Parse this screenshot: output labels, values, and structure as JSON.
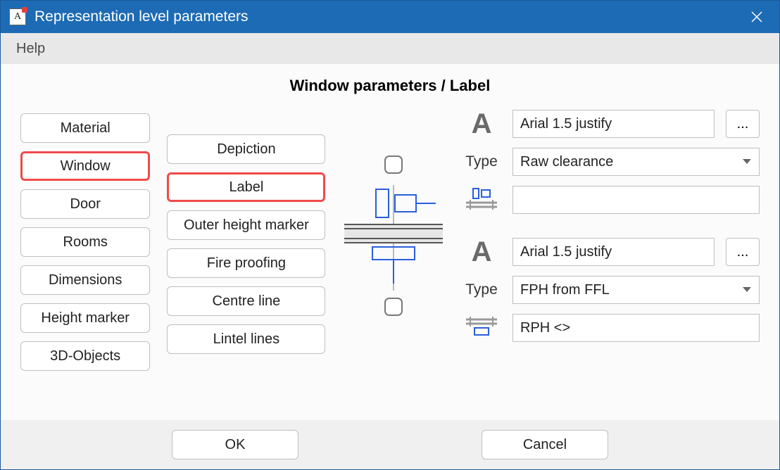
{
  "window": {
    "title": "Representation level parameters",
    "menu_help": "Help"
  },
  "heading": "Window parameters / Label",
  "left_tabs": [
    {
      "label": "Material",
      "selected": false
    },
    {
      "label": "Window",
      "selected": true
    },
    {
      "label": "Door",
      "selected": false
    },
    {
      "label": "Rooms",
      "selected": false
    },
    {
      "label": "Dimensions",
      "selected": false
    },
    {
      "label": "Height marker",
      "selected": false
    },
    {
      "label": "3D-Objects",
      "selected": false
    }
  ],
  "mid_tabs": [
    {
      "label": "Depiction",
      "selected": false
    },
    {
      "label": "Label",
      "selected": true
    },
    {
      "label": "Outer height marker",
      "selected": false
    },
    {
      "label": "Fire proofing",
      "selected": false
    },
    {
      "label": "Centre line",
      "selected": false
    },
    {
      "label": "Lintel lines",
      "selected": false
    }
  ],
  "upper": {
    "font_desc": "Arial 1.5 justify",
    "type_label": "Type",
    "type_value": "Raw clearance",
    "format_value": ""
  },
  "lower": {
    "font_desc": "Arial 1.5 justify",
    "type_label": "Type",
    "type_value": "FPH from FFL",
    "format_value": "RPH <>"
  },
  "buttons": {
    "ok": "OK",
    "cancel": "Cancel",
    "ellipsis": "..."
  }
}
